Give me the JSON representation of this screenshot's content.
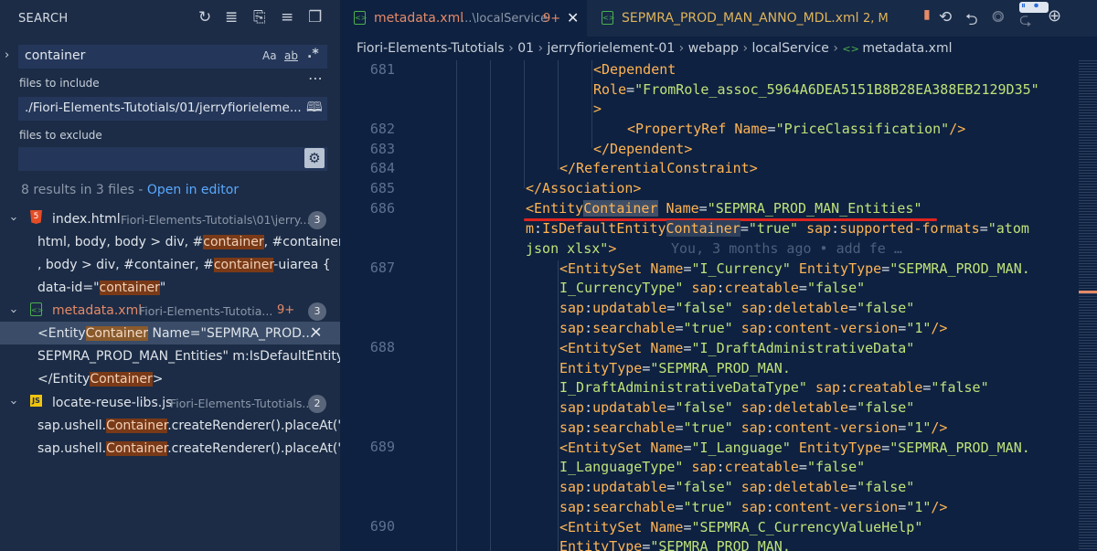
{
  "sidebar": {
    "title": "SEARCH",
    "search_value": "container",
    "case_label": "Aa",
    "word_label": "ab",
    "regex_label": ".*",
    "include_label": "files to include",
    "include_value": "./Fiori-Elements-Tutotials/01/jerryfiorieleme...",
    "exclude_label": "files to exclude",
    "results_text": "8 results in 3 files - ",
    "open_editor_label": "Open in editor",
    "files": [
      {
        "name": "index.html",
        "path": "Fiori-Elements-Tutotials\\01\\jerry...",
        "count": "3",
        "badge": "",
        "matches": [
          {
            "pre": "html, body, body > div, #",
            "hit": "container",
            "post": ", #container-u..."
          },
          {
            "pre": ", body > div, #container, #",
            "hit": "container",
            "post": "-uiarea {"
          },
          {
            "pre": "data-id=\"",
            "hit": "container",
            "post": "\""
          }
        ]
      },
      {
        "name": "metadata.xml",
        "path": "Fiori-Elements-Tutotia...",
        "count": "3",
        "badge": "9+",
        "matches": [
          {
            "pre": "<Entity",
            "hit": "Container",
            "post": " Name=\"SEPMRA_PROD..."
          },
          {
            "pre": "SEPMRA_PROD_MAN_Entities\" m:IsDefaultEntity",
            "hit": "...",
            "post": ""
          },
          {
            "pre": "</Entity",
            "hit": "Container",
            "post": ">"
          }
        ]
      },
      {
        "name": "locate-reuse-libs.js",
        "path": "Fiori-Elements-Tutotials...",
        "count": "2",
        "badge": "",
        "matches": [
          {
            "pre": "sap.ushell.",
            "hit": "Container",
            "post": ".createRenderer().placeAt(\"c..."
          },
          {
            "pre": "sap.ushell.",
            "hit": "Container",
            "post": ".createRenderer().placeAt(\"c..."
          }
        ]
      }
    ]
  },
  "tabs": [
    {
      "name": "metadata.xml",
      "desc": "...\\localService",
      "badge": "9+"
    },
    {
      "name": "SEPMRA_PROD_MAN_ANNO_MDL.xml",
      "desc": "",
      "badge": "2, M"
    }
  ],
  "breadcrumb": [
    "Fiori-Elements-Tutotials",
    "01",
    "jerryfiorielement-01",
    "webapp",
    "localService",
    "metadata.xml"
  ],
  "line_numbers": {
    "l681": "681",
    "l682": "682",
    "l683": "683",
    "l684": "684",
    "l685": "685",
    "l686": "686",
    "l687": "687",
    "l688": "688",
    "l689": "689",
    "l690": "690"
  },
  "blame": "You, 3 months ago • add fe …",
  "colors": {
    "sidebar_bg": "#1c2c46",
    "editor_bg": "#0e2140",
    "tag": "#ffb454",
    "string": "#bfe27a",
    "match": "#7a3a17",
    "underline": "#e0241f"
  }
}
